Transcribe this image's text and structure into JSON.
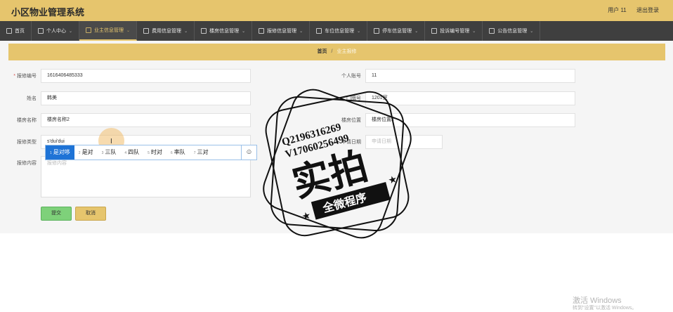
{
  "header": {
    "app_title": "小区物业管理系统",
    "user": "用户 11",
    "logout": "退出登录"
  },
  "nav": [
    {
      "label": "首页",
      "icon": "home-icon",
      "caret": false,
      "active": false
    },
    {
      "label": "个人中心",
      "icon": "user-icon",
      "caret": true,
      "active": false
    },
    {
      "label": "业主信息管理",
      "icon": "owner-icon",
      "caret": true,
      "active": true
    },
    {
      "label": "费用信息管理",
      "icon": "fee-icon",
      "caret": true,
      "active": false
    },
    {
      "label": "楼房信息管理",
      "icon": "building-icon",
      "caret": true,
      "active": false
    },
    {
      "label": "报修信息管理",
      "icon": "repair-icon",
      "caret": true,
      "active": false
    },
    {
      "label": "车位信息管理",
      "icon": "mail-icon",
      "caret": true,
      "active": false
    },
    {
      "label": "停车信息管理",
      "icon": "parking-icon",
      "caret": true,
      "active": false
    },
    {
      "label": "投诉编号管理",
      "icon": "complaint-icon",
      "caret": true,
      "active": false
    },
    {
      "label": "公告信息管理",
      "icon": "notice-icon",
      "caret": true,
      "active": false
    }
  ],
  "breadcrumb": {
    "home": "首页",
    "separator": "/",
    "current": "业主报修"
  },
  "form": {
    "repair_no": {
      "label": "报修编号",
      "value": "1616406485333"
    },
    "account": {
      "label": "个人账号",
      "value": "11"
    },
    "name": {
      "label": "姓名",
      "value": "韩美"
    },
    "room": {
      "label": "门牌号",
      "value": "1201室"
    },
    "building": {
      "label": "楼房名称",
      "value": "楼房名称2"
    },
    "location": {
      "label": "楼房位置",
      "value": "楼房位置2"
    },
    "repair_type": {
      "label": "报修类型",
      "value": "s'dui'dui"
    },
    "apply_date": {
      "label": "申请日期",
      "placeholder": "申请日期"
    },
    "repair_content": {
      "label": "报修内容",
      "placeholder": "报修内容"
    },
    "submit": "提交",
    "cancel": "取消"
  },
  "ime": {
    "candidates": [
      {
        "num": "1",
        "text": "是对哆"
      },
      {
        "num": "2",
        "text": "是对"
      },
      {
        "num": "3",
        "text": "三队"
      },
      {
        "num": "4",
        "text": "四队"
      },
      {
        "num": "5",
        "text": "时对"
      },
      {
        "num": "6",
        "text": "率队"
      },
      {
        "num": "7",
        "text": "三对"
      }
    ],
    "emoji": "☺"
  },
  "stamp": {
    "line1": "Q2196316269",
    "line2": "V17060256499",
    "main": "实拍",
    "sub": "全微程序"
  },
  "windows_watermark": {
    "title": "激活 Windows",
    "subtitle": "转到\"设置\"以激活 Windows。"
  },
  "colors": {
    "accent": "#e6c56d",
    "nav_bg": "#3f3f3f",
    "submit": "#7ed17a",
    "ime_selected": "#1e73d6"
  }
}
